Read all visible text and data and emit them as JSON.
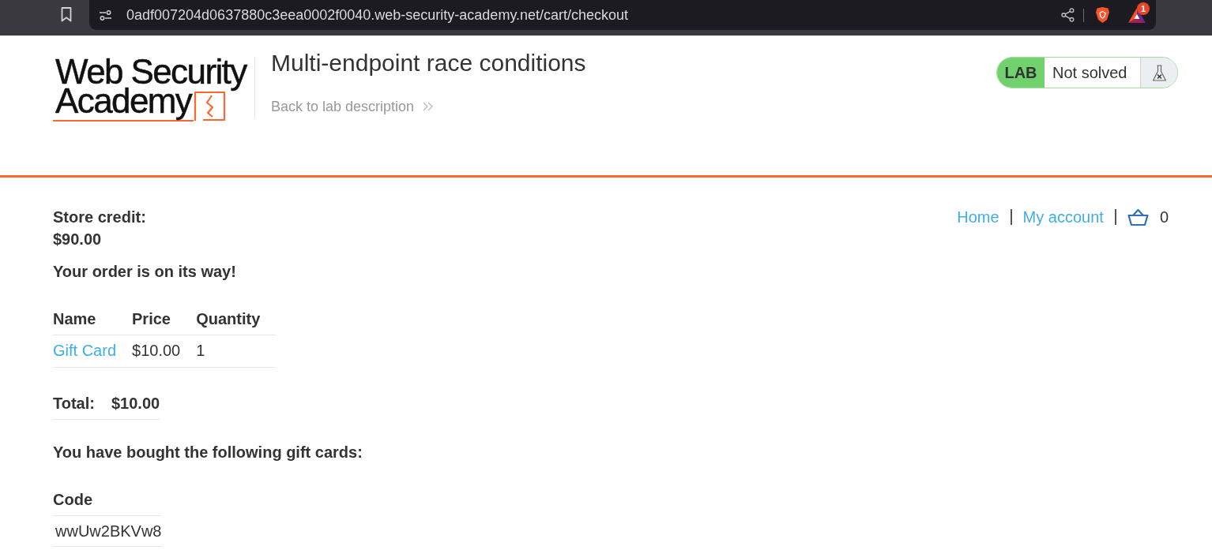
{
  "browser": {
    "url": "0adf007204d0637880c3eea0002f0040.web-security-academy.net/cart/checkout",
    "extension_badge": "1"
  },
  "header": {
    "logo": {
      "line_1": "Web Security",
      "line_2": "Academy"
    },
    "title": "Multi-endpoint race conditions",
    "back_link": "Back to lab description",
    "lab_status": {
      "label": "LAB",
      "status": "Not solved",
      "solved": false
    }
  },
  "nav": {
    "links": [
      {
        "label": "Home"
      },
      {
        "label": "My account"
      }
    ],
    "cart_count": "0"
  },
  "account": {
    "store_credit_label": "Store credit:",
    "store_credit": "$90.00",
    "message": "Your order is on its way!"
  },
  "order_table": {
    "columns": [
      "Name",
      "Price",
      "Quantity"
    ],
    "rows": [
      {
        "cells": [
          "Gift Card",
          "$10.00",
          "1"
        ]
      }
    ]
  },
  "total": {
    "label": "Total:",
    "value": "$10.00"
  },
  "gift_cards": {
    "heading": "You have bought the following gift cards:",
    "columns": [
      "Code"
    ],
    "rows": [
      {
        "cells": [
          "wwUw2BKVw8"
        ]
      }
    ]
  }
}
